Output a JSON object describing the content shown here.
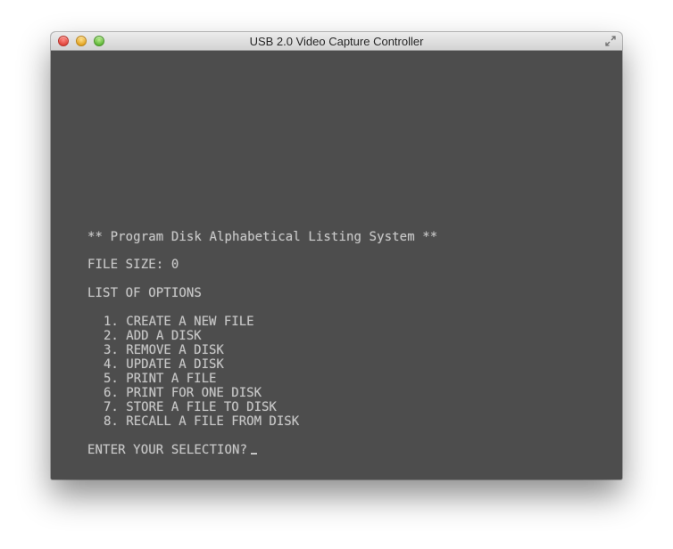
{
  "window": {
    "title": "USB 2.0 Video Capture Controller"
  },
  "terminal": {
    "heading": "** Program Disk Alphabetical Listing System **",
    "file_size_label": "FILE SIZE: 0",
    "options_title": "LIST OF OPTIONS",
    "options": [
      "1. CREATE A NEW FILE",
      "2. ADD A DISK",
      "3. REMOVE A DISK",
      "4. UPDATE A DISK",
      "5. PRINT A FILE",
      "6. PRINT FOR ONE DISK",
      "7. STORE A FILE TO DISK",
      "8. RECALL A FILE FROM DISK"
    ],
    "prompt": "ENTER YOUR SELECTION?"
  },
  "colors": {
    "screen_background": "#4d4d4d",
    "terminal_text": "#c6c6c6"
  },
  "icons": {
    "close": "close-icon",
    "minimize": "minimize-icon",
    "zoom": "zoom-icon",
    "fullscreen": "fullscreen-arrows-icon"
  }
}
